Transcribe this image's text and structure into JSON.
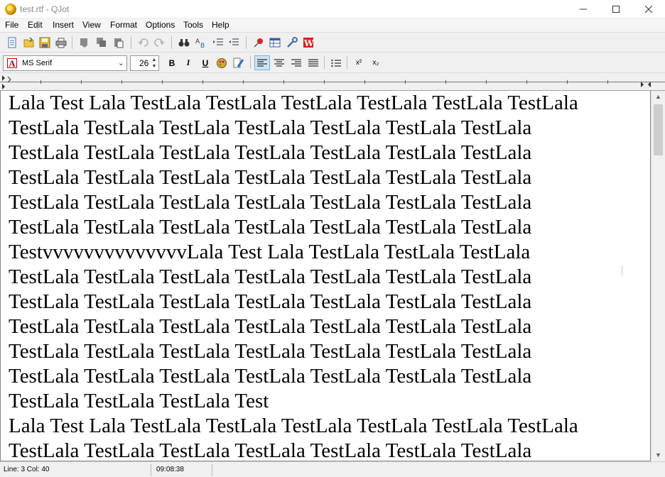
{
  "window": {
    "title": "test.rtf - QJot"
  },
  "menu": [
    "File",
    "Edit",
    "Insert",
    "View",
    "Format",
    "Options",
    "Tools",
    "Help"
  ],
  "format": {
    "font_name": "MS Serif",
    "font_size": "26",
    "bold_label": "B",
    "italic_label": "I",
    "underline_label": "U",
    "superscript_label": "x²",
    "subscript_label": "x₂"
  },
  "document": {
    "lines": [
      "Lala Test Lala TestLala TestLala TestLala TestLala TestLala TestLala",
      "TestLala TestLala TestLala TestLala TestLala TestLala TestLala",
      "TestLala TestLala TestLala TestLala TestLala TestLala TestLala",
      "TestLala TestLala TestLala TestLala TestLala TestLala TestLala",
      "TestLala TestLala TestLala TestLala TestLala TestLala TestLala",
      "TestLala TestLala TestLala TestLala TestLala TestLala TestLala",
      "TestvvvvvvvvvvvvvvLala Test Lala TestLala TestLala TestLala",
      "TestLala TestLala TestLala TestLala TestLala TestLala TestLala",
      "TestLala TestLala TestLala TestLala TestLala TestLala TestLala",
      "TestLala TestLala TestLala TestLala TestLala TestLala TestLala",
      "TestLala TestLala TestLala TestLala TestLala TestLala TestLala",
      "TestLala TestLala TestLala TestLala TestLala TestLala TestLala",
      "TestLala TestLala TestLala Test",
      "Lala Test Lala TestLala TestLala TestLala TestLala TestLala TestLala",
      "TestLala TestLala TestLala TestLala TestLala TestLala TestLala"
    ]
  },
  "status": {
    "position": "Line: 3 Col: 40",
    "time": "09:08:38"
  }
}
